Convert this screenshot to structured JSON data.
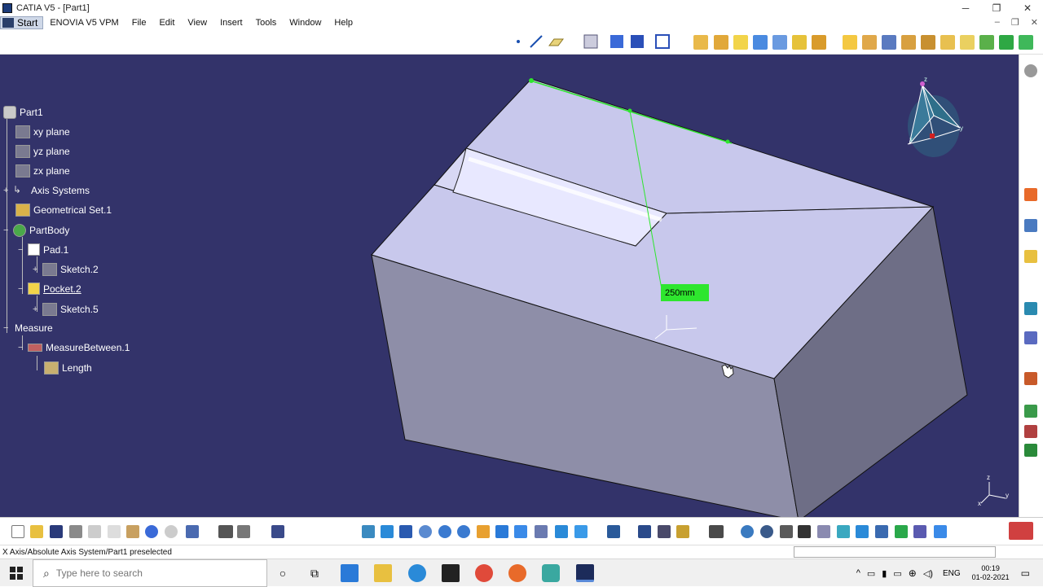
{
  "window": {
    "title": "CATIA V5 - [Part1]",
    "controls": [
      "─",
      "❐",
      "✕"
    ]
  },
  "menubar": {
    "start_label": "Start",
    "items": [
      "ENOVIA V5 VPM",
      "File",
      "Edit",
      "View",
      "Insert",
      "Tools",
      "Window",
      "Help"
    ],
    "doc_controls": [
      "–",
      "❐",
      "✕"
    ]
  },
  "tree": {
    "nodes": [
      {
        "label": "Part1"
      },
      {
        "label": "xy plane"
      },
      {
        "label": "yz plane"
      },
      {
        "label": "zx plane"
      },
      {
        "label": "Axis Systems"
      },
      {
        "label": "Geometrical Set.1"
      },
      {
        "label": "PartBody"
      },
      {
        "label": "Pad.1"
      },
      {
        "label": "Sketch.2"
      },
      {
        "label": "Pocket.2"
      },
      {
        "label": "Sketch.5"
      },
      {
        "label": "Measure"
      },
      {
        "label": "MeasureBetween.1"
      },
      {
        "label": "Length"
      }
    ]
  },
  "viewport": {
    "measure_label": "250mm",
    "compass_axes": [
      "z",
      "y",
      "x"
    ],
    "triad_axes": [
      "z",
      "y",
      "x"
    ],
    "colors": {
      "background": "#33336a",
      "top_face": "#c8c8ec",
      "front_face": "#8e8ea8",
      "side_face": "#6e6e86",
      "measure": "#2ee62e"
    }
  },
  "statusbar": {
    "text": "X Axis/Absolute Axis System/Part1 preselected"
  },
  "taskbar": {
    "search_placeholder": "Type here to search",
    "tray": {
      "language": "ENG",
      "time": "00:19",
      "date": "01-02-2021"
    }
  }
}
